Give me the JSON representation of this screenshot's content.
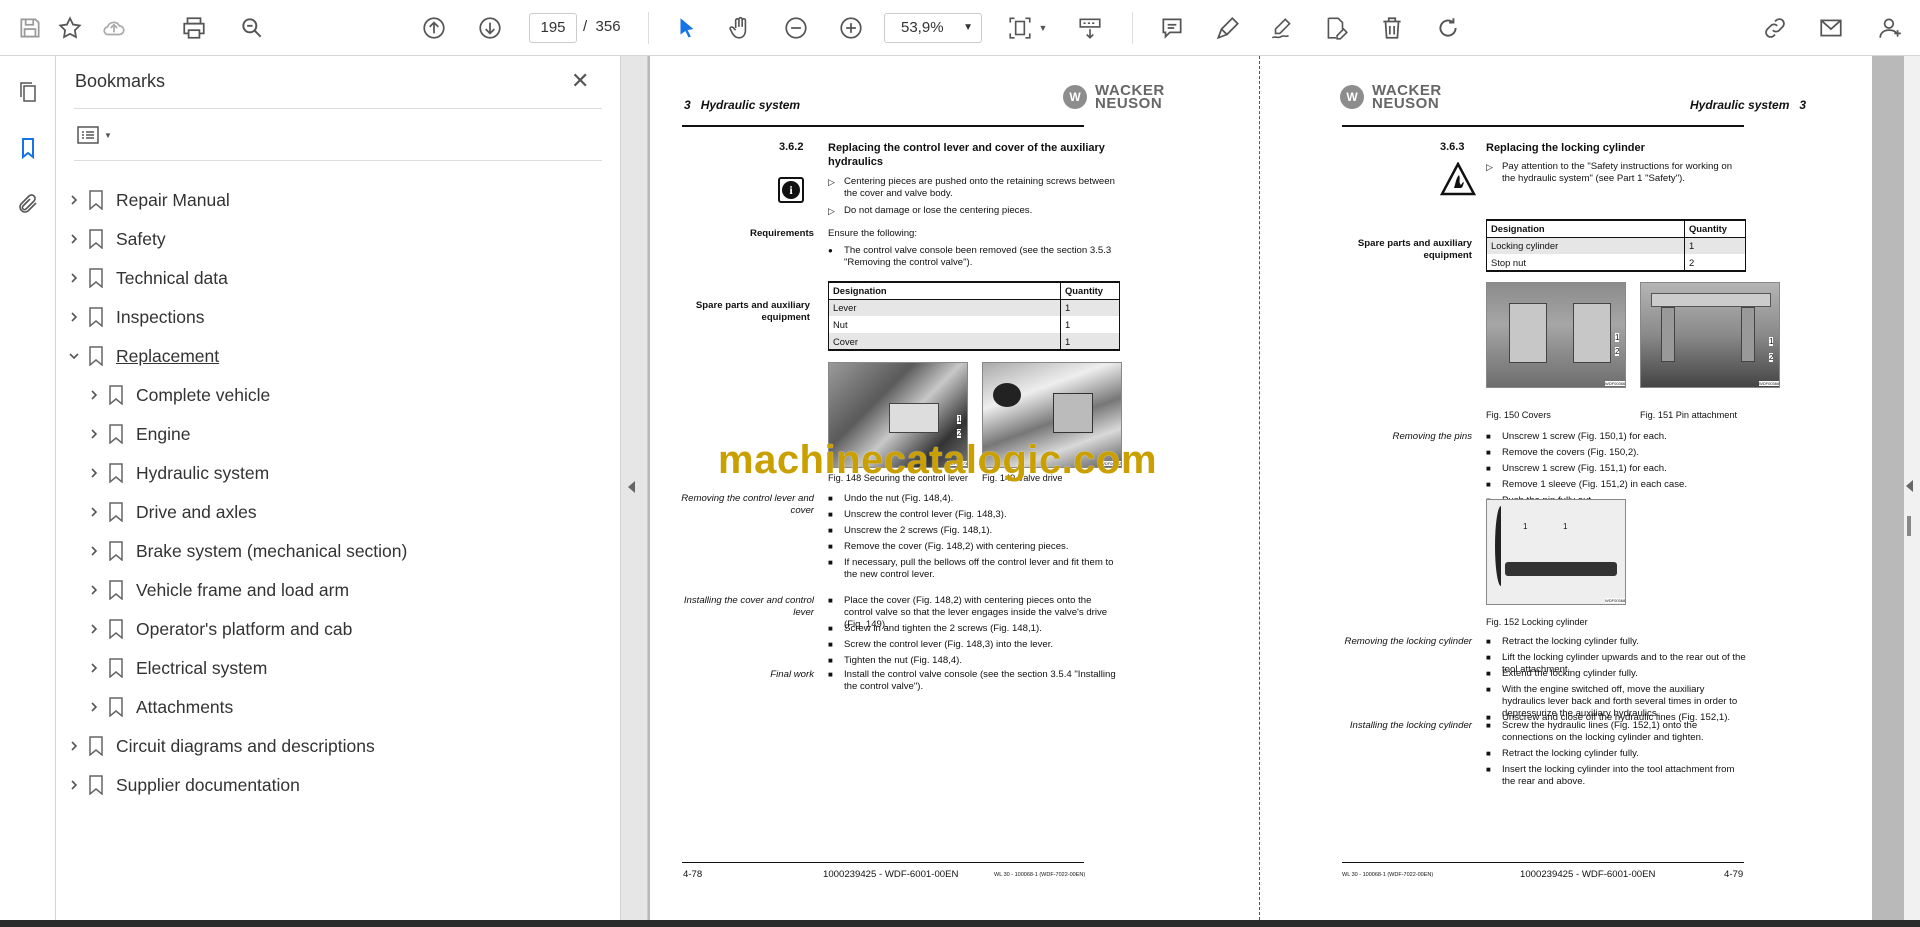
{
  "toolbar": {
    "current_page": "195",
    "page_separator": "/",
    "total_pages": "356",
    "zoom": "53,9%",
    "icons": [
      "save-icon",
      "star-icon",
      "cloud-upload-icon",
      "print-icon",
      "zoom-search-icon",
      "page-up-icon",
      "page-down-icon",
      "select-cursor-icon",
      "hand-icon",
      "zoom-out-icon",
      "zoom-in-icon",
      "page-fit-icon",
      "scroll-mode-icon",
      "comment-icon",
      "highlight-icon",
      "sign-icon",
      "fill-sign-icon",
      "delete-icon",
      "rotate-icon",
      "share-link-icon",
      "email-icon",
      "user-icon"
    ]
  },
  "bookmarks": {
    "title": "Bookmarks",
    "items": [
      {
        "label": "Repair Manual",
        "level": 0,
        "expanded": false
      },
      {
        "label": "Safety",
        "level": 0,
        "expanded": false
      },
      {
        "label": "Technical data",
        "level": 0,
        "expanded": false
      },
      {
        "label": "Inspections",
        "level": 0,
        "expanded": false
      },
      {
        "label": "Replacement",
        "level": 0,
        "expanded": true
      },
      {
        "label": "Complete vehicle",
        "level": 1,
        "expanded": false
      },
      {
        "label": "Engine",
        "level": 1,
        "expanded": false
      },
      {
        "label": "Hydraulic system",
        "level": 1,
        "expanded": false
      },
      {
        "label": "Drive and axles",
        "level": 1,
        "expanded": false
      },
      {
        "label": "Brake system (mechanical section)",
        "level": 1,
        "expanded": false
      },
      {
        "label": "Vehicle frame and load arm",
        "level": 1,
        "expanded": false
      },
      {
        "label": "Operator's platform and cab",
        "level": 1,
        "expanded": false
      },
      {
        "label": "Electrical system",
        "level": 1,
        "expanded": false
      },
      {
        "label": "Attachments",
        "level": 1,
        "expanded": false
      },
      {
        "label": "Circuit diagrams and descriptions",
        "level": 0,
        "expanded": false
      },
      {
        "label": "Supplier documentation",
        "level": 0,
        "expanded": false
      }
    ]
  },
  "watermark": "machinecatalogic.com",
  "left_page": {
    "chapter": "3",
    "chapter_title": "Hydraulic system",
    "logo_line1": "WACKER",
    "logo_line2": "NEUSON",
    "section_num": "3.6.2",
    "section_title": "Replacing the control lever and cover of the auxiliary hydraulics",
    "notes": [
      "Centering pieces are pushed onto the retaining screws between the cover and valve body.",
      "Do not damage or lose the centering pieces."
    ],
    "req_label": "Requirements",
    "req_intro": "Ensure the following:",
    "req_item": "The control valve console been removed (see the section 3.5.3 \"Removing the control valve\").",
    "spares_label": "Spare parts and auxiliary equipment",
    "table_head": [
      "Designation",
      "Quantity"
    ],
    "table_rows": [
      [
        "Lever",
        "1"
      ],
      [
        "Nut",
        "1"
      ],
      [
        "Cover",
        "1"
      ]
    ],
    "fig148_caption": "Fig. 148   Securing the control lever",
    "fig149_caption": "Fig. 149   Valve drive",
    "fig148_code": "WDF00373",
    "fig149_code": "WDF00372",
    "removing_label": "Removing the control lever and cover",
    "removing_steps": [
      "Undo the nut (Fig. 148,4).",
      "Unscrew the control lever (Fig. 148,3).",
      "Unscrew the 2 screws (Fig. 148,1).",
      "Remove the cover (Fig. 148,2) with centering pieces.",
      "If necessary, pull the bellows off the control lever and fit them to the new control lever."
    ],
    "installing_label": "Installing the cover and control lever",
    "installing_steps": [
      "Place the cover (Fig. 148,2) with centering pieces onto the control valve so that the lever engages inside the valve's drive (Fig. 149).",
      "Screw in and tighten the 2 screws (Fig. 148,1).",
      "Screw the control lever (Fig. 148,3) into the lever.",
      "Tighten the nut (Fig. 148,4)."
    ],
    "final_label": "Final work",
    "final_steps": [
      "Install the control valve console (see the section 3.5.4 \"Installing the control valve\")."
    ],
    "footer_page": "4-78",
    "footer_doc": "1000239425 - WDF-6001-00EN",
    "footer_small": "WL 30 - 100068-1 (WDF-7022-00EN)"
  },
  "right_page": {
    "chapter": "3",
    "chapter_title": "Hydraulic system",
    "logo_line1": "WACKER",
    "logo_line2": "NEUSON",
    "section_num": "3.6.3",
    "section_title": "Replacing the locking cylinder",
    "notes": [
      "Pay attention to the \"Safety instructions for working on the hydraulic system\" (see Part 1 \"Safety\")."
    ],
    "spares_label": "Spare parts and auxiliary equipment",
    "table_head": [
      "Designation",
      "Quantity"
    ],
    "table_rows": [
      [
        "Locking cylinder",
        "1"
      ],
      [
        "Stop nut",
        "2"
      ]
    ],
    "fig150_caption": "Fig. 150   Covers",
    "fig151_caption": "Fig. 151   Pin attachment",
    "fig152_caption": "Fig. 152   Locking cylinder",
    "fig150_code": "WDF00366",
    "fig151_code": "WDF00366",
    "fig152_code": "WDF00368",
    "pins_label": "Removing the pins",
    "pins_steps": [
      "Unscrew 1 screw (Fig. 150,1) for each.",
      "Remove the covers (Fig. 150,2).",
      "Unscrew 1 screw (Fig. 151,1) for each.",
      "Remove 1 sleeve (Fig. 151,2) in each case.",
      "Push the pin fully out."
    ],
    "remove_label": "Removing the locking cylinder",
    "remove_steps": [
      "Retract the locking cylinder fully.",
      "Lift the locking cylinder upwards and to the rear out of the tool attachment.",
      "Extend the locking cylinder fully.",
      "With the engine switched off, move the auxiliary hydraulics lever back and forth several times in order to depressurize the auxiliary hydraulics.",
      "Unscrew and close off the hydraulic lines (Fig. 152,1)."
    ],
    "install_label": "Installing the locking cylinder",
    "install_steps": [
      "Screw the hydraulic lines (Fig. 152,1) onto the connections on the locking cylinder and tighten.",
      "Retract the locking cylinder fully.",
      "Insert the locking cylinder into the tool attachment from the rear and above."
    ],
    "footer_page": "4-79",
    "footer_doc": "1000239425 - WDF-6001-00EN",
    "footer_small": "WL 30 - 100068-1 (WDF-7022-00EN)"
  }
}
